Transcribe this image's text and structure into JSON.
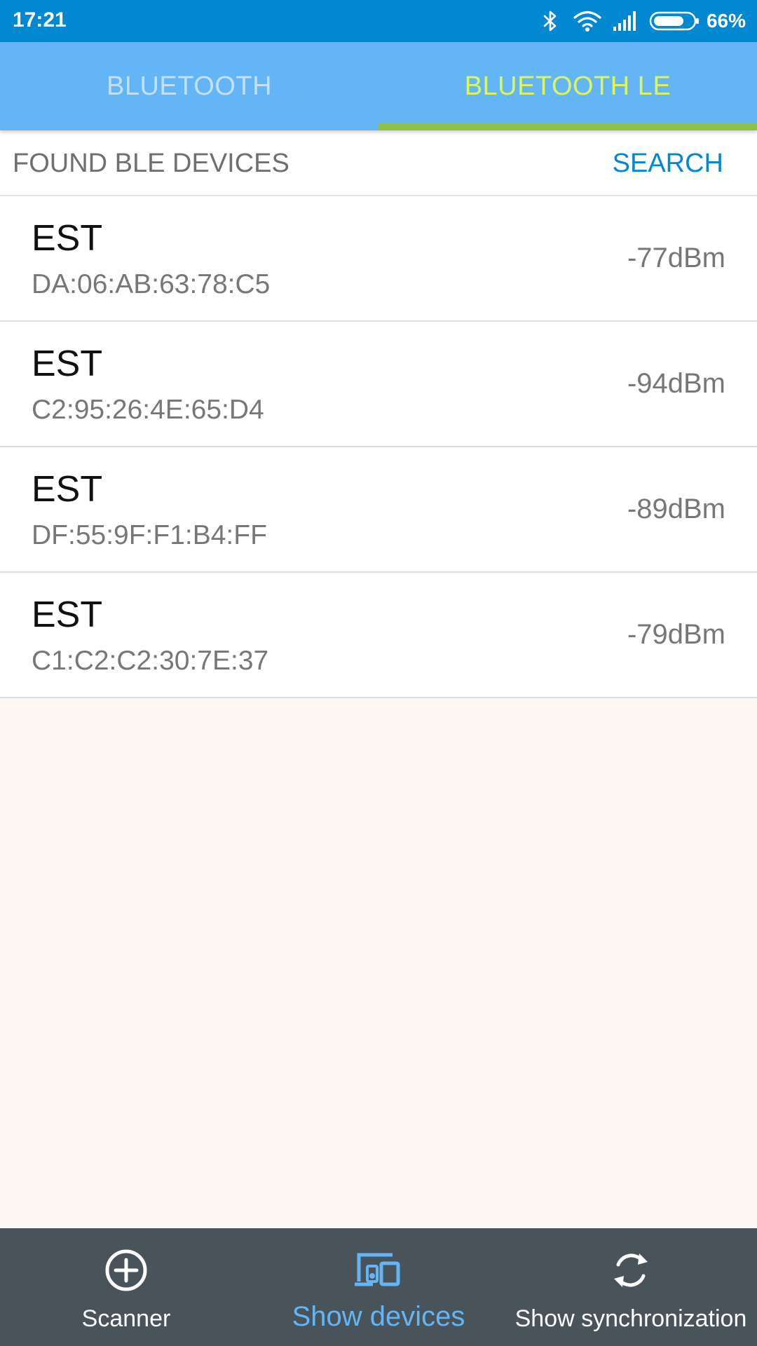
{
  "status_bar": {
    "time": "17:21",
    "battery": "66%",
    "icons": [
      "bluetooth-icon",
      "wifi-icon",
      "signal-icon",
      "battery-icon"
    ]
  },
  "tabs": [
    {
      "label": "BLUETOOTH",
      "active": false
    },
    {
      "label": "BLUETOOTH LE",
      "active": true
    }
  ],
  "list": {
    "title": "FOUND BLE DEVICES",
    "search_label": "SEARCH",
    "devices": [
      {
        "name": "EST",
        "mac": "DA:06:AB:63:78:C5",
        "rssi": "-77dBm"
      },
      {
        "name": "EST",
        "mac": "C2:95:26:4E:65:D4",
        "rssi": "-94dBm"
      },
      {
        "name": "EST",
        "mac": "DF:55:9F:F1:B4:FF",
        "rssi": "-89dBm"
      },
      {
        "name": "EST",
        "mac": "C1:C2:C2:30:7E:37",
        "rssi": "-79dBm"
      }
    ]
  },
  "bottom_nav": [
    {
      "label": "Scanner",
      "icon": "add-circle-icon",
      "active": false
    },
    {
      "label": "Show devices",
      "icon": "devices-icon",
      "active": true
    },
    {
      "label": "Show synchronization",
      "icon": "sync-icon",
      "active": false
    }
  ],
  "colors": {
    "status_bar": "#0288d1",
    "tab_bar": "#64b5f6",
    "tab_active_text": "#dcf55a",
    "tab_indicator": "#8bc34a",
    "accent": "#0288d1",
    "bottom_nav": "#48535a",
    "nav_active": "#64b5f6",
    "background": "#fcf7f3"
  }
}
